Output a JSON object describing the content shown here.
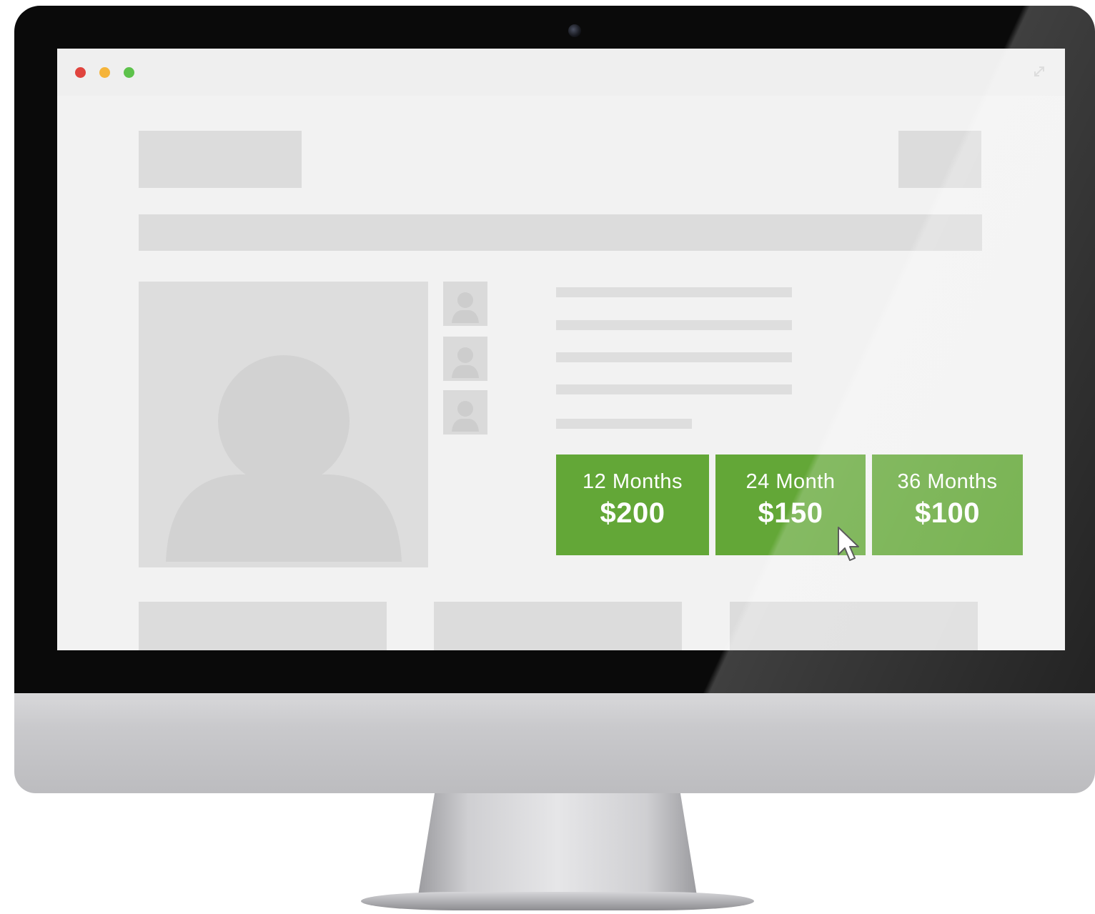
{
  "window": {
    "controls": {
      "close_color": "#e0443e",
      "minimize_color": "#f5b43a",
      "zoom_color": "#5dc24b"
    },
    "expand_icon": "expand-arrows-icon"
  },
  "pricing": {
    "accent_color": "#63a737",
    "options": [
      {
        "term": "12 Months",
        "price": "$200"
      },
      {
        "term": "24 Month",
        "price": "$150"
      },
      {
        "term": "36 Months",
        "price": "$100"
      }
    ]
  },
  "placeholders": {
    "main_image_icon": "user-avatar-icon",
    "thumbnail_icon": "user-avatar-icon"
  },
  "cursor": {
    "icon": "arrow-pointer-icon",
    "hovering": "24 Month"
  }
}
